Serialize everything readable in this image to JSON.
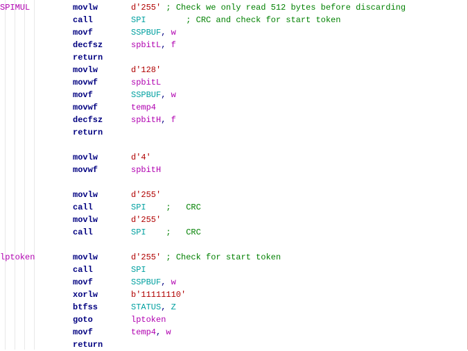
{
  "lines": [
    {
      "label": "SPIMUL",
      "op": "movlw",
      "args": [
        {
          "t": "lit",
          "v": "d'255'"
        }
      ],
      "argpad": 7,
      "comment": "; Check we only read 512 bytes before discarding"
    },
    {
      "label": "",
      "op": "call",
      "args": [
        {
          "t": "sfr",
          "v": "SPI"
        }
      ],
      "argpad": 11,
      "comment": "; CRC and check for start token"
    },
    {
      "label": "",
      "op": "movf",
      "args": [
        {
          "t": "sfr",
          "v": "SSPBUF"
        },
        {
          "t": "oper",
          "v": ", "
        },
        {
          "t": "ident",
          "v": "w"
        }
      ]
    },
    {
      "label": "",
      "op": "decfsz",
      "args": [
        {
          "t": "ident",
          "v": "spbitL"
        },
        {
          "t": "oper",
          "v": ", "
        },
        {
          "t": "ident",
          "v": "f"
        }
      ]
    },
    {
      "label": "",
      "op": "return",
      "args": []
    },
    {
      "label": "",
      "op": "movlw",
      "args": [
        {
          "t": "lit",
          "v": "d'128'"
        }
      ]
    },
    {
      "label": "",
      "op": "movwf",
      "args": [
        {
          "t": "ident",
          "v": "spbitL"
        }
      ]
    },
    {
      "label": "",
      "op": "movf",
      "args": [
        {
          "t": "sfr",
          "v": "SSPBUF"
        },
        {
          "t": "oper",
          "v": ", "
        },
        {
          "t": "ident",
          "v": "w"
        }
      ]
    },
    {
      "label": "",
      "op": "movwf",
      "args": [
        {
          "t": "ident",
          "v": "temp4"
        }
      ]
    },
    {
      "label": "",
      "op": "decfsz",
      "args": [
        {
          "t": "ident",
          "v": "spbitH"
        },
        {
          "t": "oper",
          "v": ", "
        },
        {
          "t": "ident",
          "v": "f"
        }
      ]
    },
    {
      "label": "",
      "op": "return",
      "args": []
    },
    {
      "blank": true
    },
    {
      "label": "",
      "op": "movlw",
      "args": [
        {
          "t": "lit",
          "v": "d'4'"
        }
      ]
    },
    {
      "label": "",
      "op": "movwf",
      "args": [
        {
          "t": "ident",
          "v": "spbitH"
        }
      ]
    },
    {
      "blank": true
    },
    {
      "label": "",
      "op": "movlw",
      "args": [
        {
          "t": "lit",
          "v": "d'255'"
        }
      ]
    },
    {
      "label": "",
      "op": "call",
      "args": [
        {
          "t": "sfr",
          "v": "SPI"
        }
      ],
      "argpad": 7,
      "comment": ";   CRC"
    },
    {
      "label": "",
      "op": "movlw",
      "args": [
        {
          "t": "lit",
          "v": "d'255'"
        }
      ]
    },
    {
      "label": "",
      "op": "call",
      "args": [
        {
          "t": "sfr",
          "v": "SPI"
        }
      ],
      "argpad": 7,
      "comment": ";   CRC"
    },
    {
      "blank": true
    },
    {
      "label": "lptoken",
      "op": "movlw",
      "args": [
        {
          "t": "lit",
          "v": "d'255'"
        }
      ],
      "argpad": 7,
      "comment": "; Check for start token"
    },
    {
      "label": "",
      "op": "call",
      "args": [
        {
          "t": "sfr",
          "v": "SPI"
        }
      ]
    },
    {
      "label": "",
      "op": "movf",
      "args": [
        {
          "t": "sfr",
          "v": "SSPBUF"
        },
        {
          "t": "oper",
          "v": ", "
        },
        {
          "t": "ident",
          "v": "w"
        }
      ]
    },
    {
      "label": "",
      "op": "xorlw",
      "args": [
        {
          "t": "lit",
          "v": "b'11111110'"
        }
      ]
    },
    {
      "label": "",
      "op": "btfss",
      "args": [
        {
          "t": "sfr",
          "v": "STATUS"
        },
        {
          "t": "oper",
          "v": ", "
        },
        {
          "t": "sfr",
          "v": "Z"
        }
      ]
    },
    {
      "label": "",
      "op": "goto",
      "args": [
        {
          "t": "ident",
          "v": "lptoken"
        }
      ]
    },
    {
      "label": "",
      "op": "movf",
      "args": [
        {
          "t": "ident",
          "v": "temp4"
        },
        {
          "t": "oper",
          "v": ", "
        },
        {
          "t": "ident",
          "v": "w"
        }
      ]
    },
    {
      "label": "",
      "op": "return",
      "args": []
    }
  ]
}
